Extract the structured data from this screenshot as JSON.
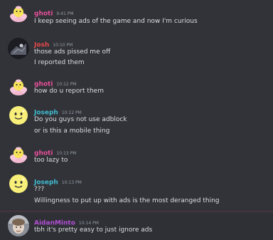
{
  "messages": [
    {
      "author": "ghoti",
      "timestamp": "9:41 PM",
      "avatar": "ghoti-avatar",
      "lines": [
        "I keep seeing ads of the game and now I'm curious"
      ]
    },
    {
      "author": "Josh",
      "timestamp": "10:10 PM",
      "avatar": "josh-avatar",
      "lines": [
        "those ads pissed me off",
        "I reported them"
      ]
    },
    {
      "author": "ghoti",
      "timestamp": "10:12 PM",
      "avatar": "ghoti-avatar",
      "lines": [
        "how do u report them"
      ]
    },
    {
      "author": "Joseph",
      "timestamp": "10:12 PM",
      "avatar": "joseph-avatar",
      "lines": [
        "Do you guys not use adblock",
        "or is this a mobile thing"
      ]
    },
    {
      "author": "ghoti",
      "timestamp": "10:13 PM",
      "avatar": "ghoti-avatar",
      "lines": [
        "too lazy to"
      ]
    },
    {
      "author": "Joseph",
      "timestamp": "10:13 PM",
      "avatar": "joseph-avatar",
      "lines": [
        "???",
        "Willingness to put up with ads is the most deranged thing"
      ]
    },
    {
      "author": "AidanMinto",
      "timestamp": "10:14 PM",
      "avatar": "aidan-avatar",
      "lines": [
        "tbh it's pretty easy to just ignore ads"
      ]
    }
  ],
  "colors": {
    "background": "#313338",
    "ghoti": "#e84f9a",
    "josh": "#e8484a",
    "joseph": "#3fbbd1",
    "aidan": "#b34fd6",
    "text": "#dbdee1",
    "timestamp": "#949ba4"
  }
}
